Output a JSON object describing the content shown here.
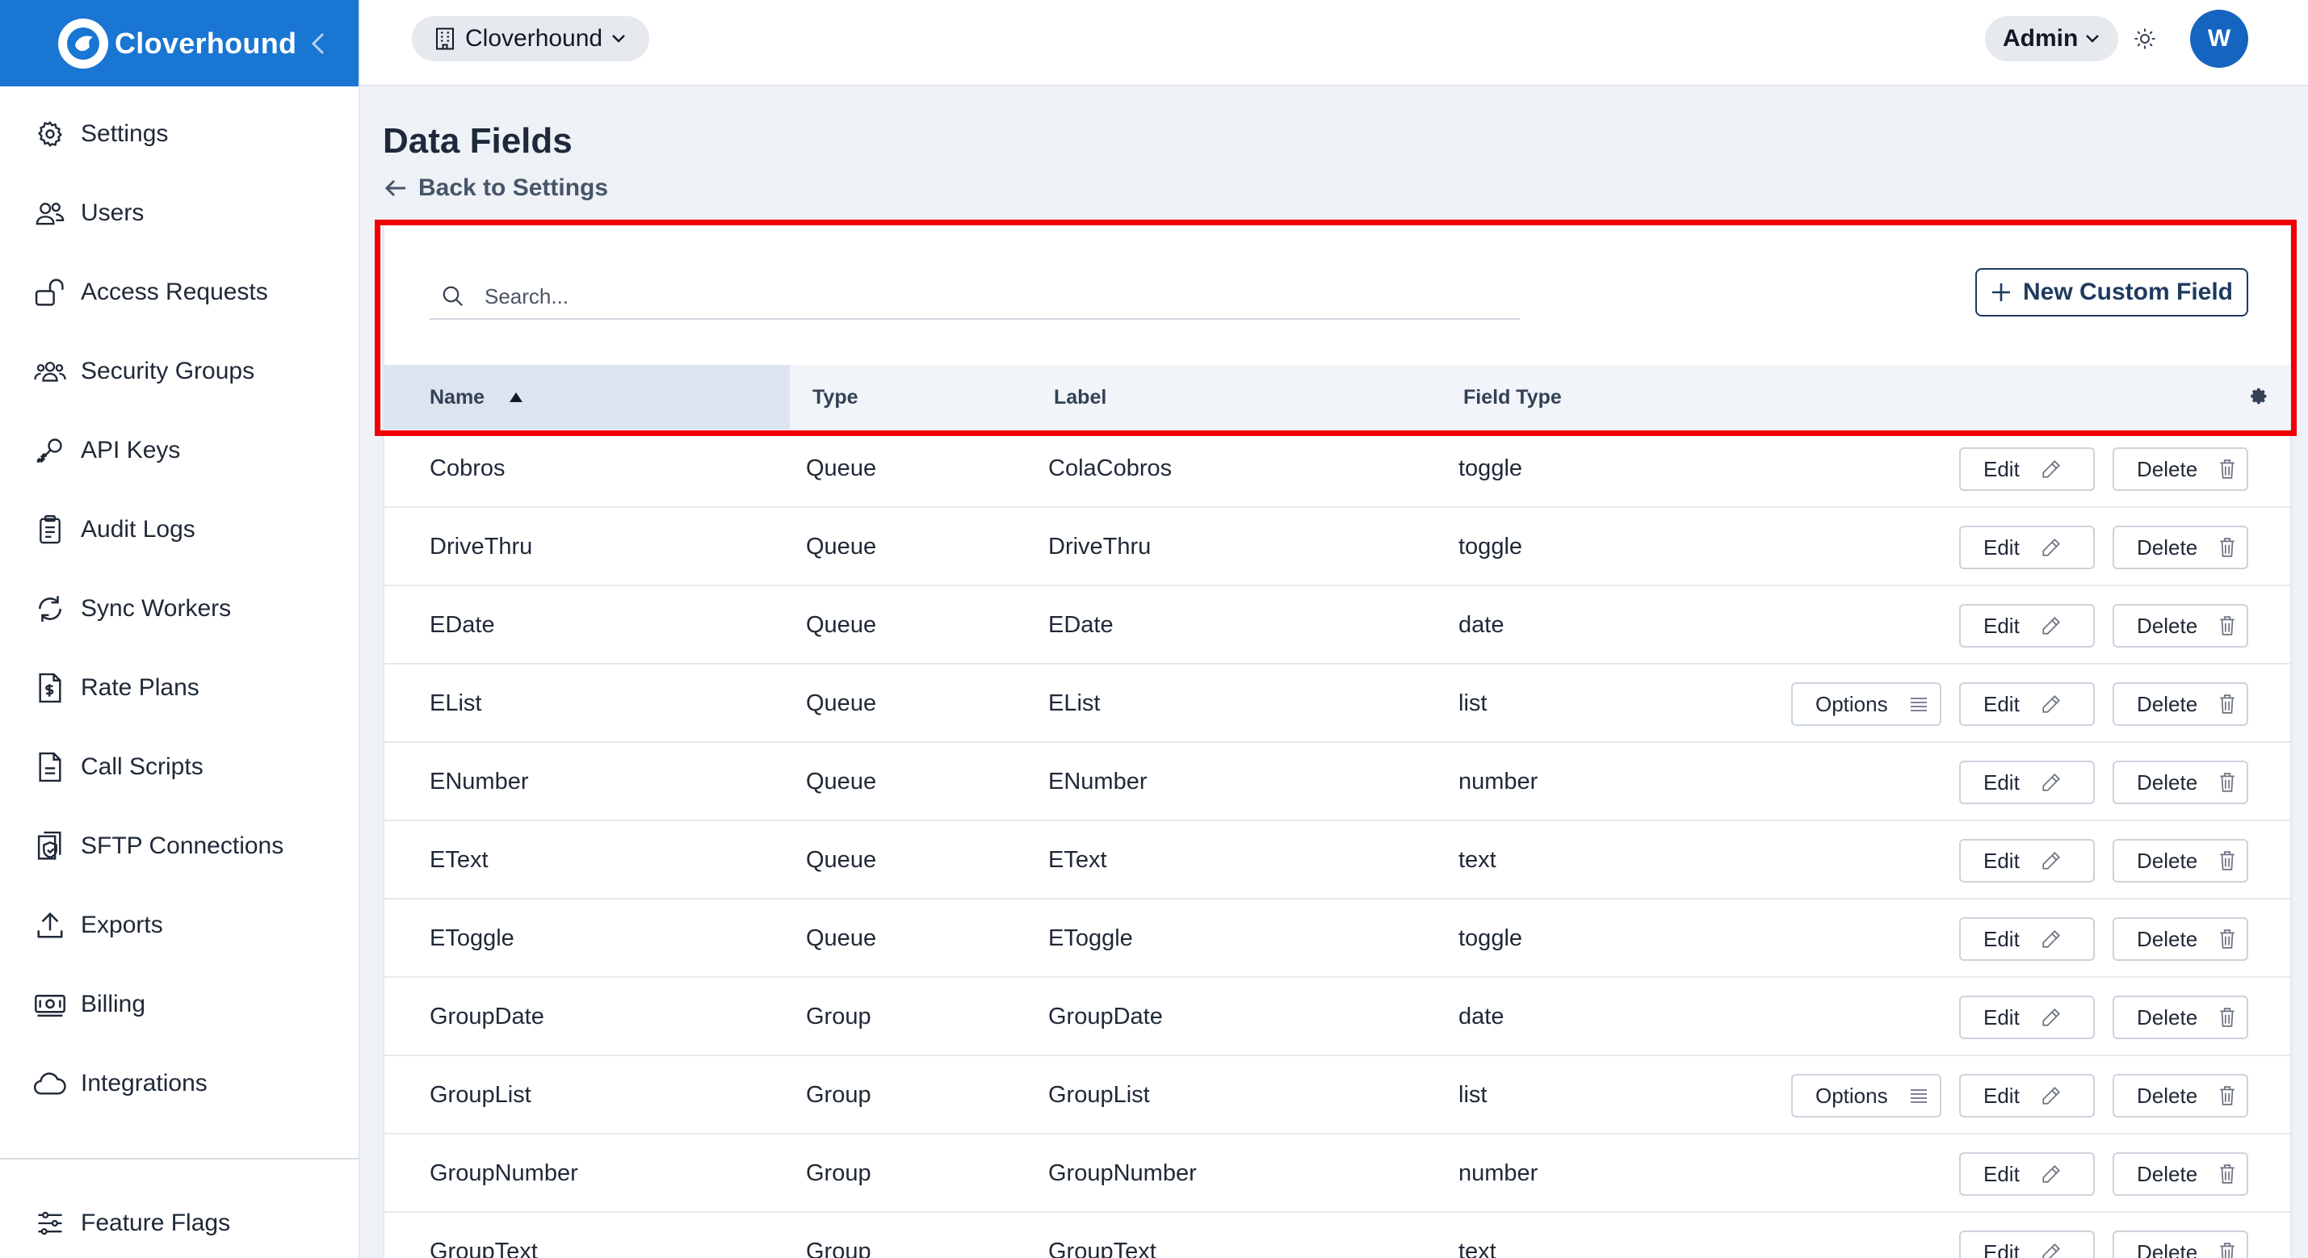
{
  "app": {
    "name": "Cloverhound"
  },
  "sidebar": {
    "items": [
      {
        "label": "Settings",
        "icon": "gear-icon"
      },
      {
        "label": "Users",
        "icon": "users-icon"
      },
      {
        "label": "Access Requests",
        "icon": "unlock-icon"
      },
      {
        "label": "Security Groups",
        "icon": "group-icon"
      },
      {
        "label": "API Keys",
        "icon": "key-icon"
      },
      {
        "label": "Audit Logs",
        "icon": "clipboard-icon"
      },
      {
        "label": "Sync Workers",
        "icon": "sync-icon"
      },
      {
        "label": "Rate Plans",
        "icon": "dollar-doc-icon"
      },
      {
        "label": "Call Scripts",
        "icon": "document-icon"
      },
      {
        "label": "SFTP Connections",
        "icon": "shield-check-icon"
      },
      {
        "label": "Exports",
        "icon": "upload-icon"
      },
      {
        "label": "Billing",
        "icon": "cash-icon"
      },
      {
        "label": "Integrations",
        "icon": "cloud-icon"
      }
    ],
    "bottom_item": {
      "label": "Feature Flags",
      "icon": "sliders-icon"
    }
  },
  "header": {
    "org": "Cloverhound",
    "role": "Admin",
    "avatar_initial": "W"
  },
  "page": {
    "title": "Data Fields",
    "back_label": "Back to Settings"
  },
  "toolbar": {
    "search_placeholder": "Search...",
    "new_button": "New Custom Field"
  },
  "table": {
    "columns": [
      "Name",
      "Type",
      "Label",
      "Field Type"
    ],
    "sort": {
      "column": "Name",
      "direction": "ascending"
    },
    "button_labels": {
      "options": "Options",
      "edit": "Edit",
      "delete": "Delete"
    },
    "rows": [
      {
        "name": "Cobros",
        "type": "Queue",
        "label": "ColaCobros",
        "field_type": "toggle",
        "has_options": false
      },
      {
        "name": "DriveThru",
        "type": "Queue",
        "label": "DriveThru",
        "field_type": "toggle",
        "has_options": false
      },
      {
        "name": "EDate",
        "type": "Queue",
        "label": "EDate",
        "field_type": "date",
        "has_options": false
      },
      {
        "name": "EList",
        "type": "Queue",
        "label": "EList",
        "field_type": "list",
        "has_options": true
      },
      {
        "name": "ENumber",
        "type": "Queue",
        "label": "ENumber",
        "field_type": "number",
        "has_options": false
      },
      {
        "name": "EText",
        "type": "Queue",
        "label": "EText",
        "field_type": "text",
        "has_options": false
      },
      {
        "name": "EToggle",
        "type": "Queue",
        "label": "EToggle",
        "field_type": "toggle",
        "has_options": false
      },
      {
        "name": "GroupDate",
        "type": "Group",
        "label": "GroupDate",
        "field_type": "date",
        "has_options": false
      },
      {
        "name": "GroupList",
        "type": "Group",
        "label": "GroupList",
        "field_type": "list",
        "has_options": true
      },
      {
        "name": "GroupNumber",
        "type": "Group",
        "label": "GroupNumber",
        "field_type": "number",
        "has_options": false
      },
      {
        "name": "GroupText",
        "type": "Group",
        "label": "GroupText",
        "field_type": "text",
        "has_options": false
      }
    ]
  },
  "colors": {
    "brand": "#1976d2",
    "highlight": "#f20006",
    "avatar": "#1565c0",
    "primary_outline": "#1e3a5f"
  }
}
